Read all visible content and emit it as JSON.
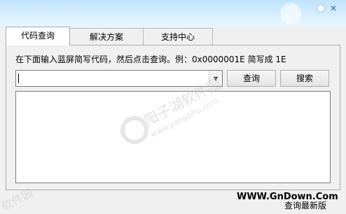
{
  "tabs": [
    {
      "label": "代码查询",
      "active": true
    },
    {
      "label": "解决方案",
      "active": false
    },
    {
      "label": "支持中心",
      "active": false
    }
  ],
  "query": {
    "hint": "在下面输入蓝屏简写代码，然后点击查询。例：0x0000001E 简写成 1E",
    "input_value": "",
    "query_label": "查询",
    "search_label": "搜索"
  },
  "result": {
    "text": ""
  },
  "footer": {
    "site": "WWW.GnDown.Com",
    "update_label": "查询最新版"
  },
  "watermarks": {
    "main": "阳子湖软件园",
    "url": "www.yangzihu.com",
    "bottom": "软件园"
  },
  "colors": {
    "titlebar": "#cbe7fb",
    "panel": "#f0f0f0"
  }
}
